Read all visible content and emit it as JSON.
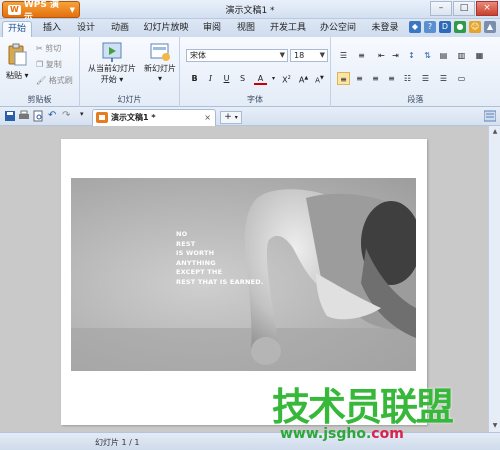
{
  "app": {
    "badge": "W",
    "name": "WPS 演示",
    "title": "演示文稿1 *"
  },
  "menu_tabs": [
    "开始",
    "插入",
    "设计",
    "动画",
    "幻灯片放映",
    "审阅",
    "视图",
    "开发工具",
    "办公空间",
    "未登录"
  ],
  "ribbon": {
    "clipboard": {
      "paste": "粘贴",
      "cut": "剪切",
      "copy": "复制",
      "format": "格式刷",
      "group": "剪贴板"
    },
    "slides": {
      "from_current": "从当前幻灯片",
      "start": "开始",
      "new_slide": "新幻灯片",
      "group": "幻灯片"
    },
    "font": {
      "family": "宋体",
      "size": "18",
      "bold": "B",
      "italic": "I",
      "underline": "U",
      "shadow": "S",
      "color": "A",
      "sup": "X",
      "grow": "A",
      "shrink": "A",
      "group": "字体"
    },
    "paragraph": {
      "group": "段落"
    }
  },
  "document": {
    "tab_title": "演示文稿1 *",
    "close": "×",
    "add": "+"
  },
  "slide": {
    "quote_lines": [
      "NO",
      "REST",
      "IS WORTH",
      "ANYTHING",
      "EXCEPT THE",
      "REST THAT IS EARNED."
    ]
  },
  "status": {
    "slide_count": "幻灯片 1 / 1"
  },
  "watermark": {
    "cn": "技术员联盟",
    "url_main": "www.jsgho.",
    "url_tld": "com"
  },
  "colors": {
    "accent": "#e2700e",
    "ribbon": "#e4ecf7",
    "watermark_green": "#37b83a",
    "watermark_red": "#d9224c"
  }
}
